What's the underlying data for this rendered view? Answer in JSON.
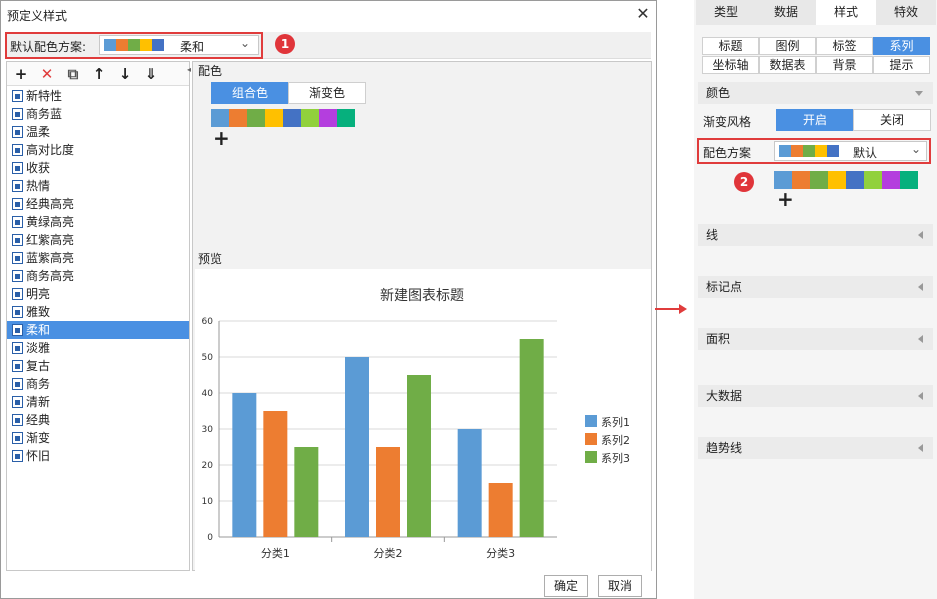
{
  "dialog": {
    "title": "预定义样式",
    "close": "✕",
    "default_scheme_label": "默认配色方案:",
    "default_scheme_value": "柔和",
    "marker": "1",
    "toolbar_icons": [
      "plus-icon",
      "delete-icon",
      "copy-icon",
      "up-arrow-icon",
      "down-arrow-icon",
      "sort-down-icon"
    ],
    "toolbar_glyphs": [
      "+",
      "✕",
      "⧉",
      "↑",
      "↓",
      "⇓"
    ],
    "schemes": [
      "新特性",
      "商务蓝",
      "温柔",
      "高对比度",
      "收获",
      "热情",
      "经典高亮",
      "黄绿高亮",
      "红紫高亮",
      "蓝紫高亮",
      "商务高亮",
      "明亮",
      "雅致",
      "柔和",
      "淡雅",
      "复古",
      "商务",
      "清新",
      "经典",
      "渐变",
      "怀旧"
    ],
    "selected_index": 13,
    "color_section_label": "配色",
    "color_tabs": [
      "组合色",
      "渐变色"
    ],
    "palette_colors": [
      "#5b9bd5",
      "#ed7d31",
      "#70ad47",
      "#ffc000",
      "#4472c4",
      "#91d13c",
      "#b43ede",
      "#06b07d"
    ],
    "scheme_swatch_colors": [
      "#5b9bd5",
      "#ed7d31",
      "#70ad47",
      "#ffc000",
      "#4472c4"
    ],
    "add": "+",
    "preview_label": "预览",
    "ok": "确定",
    "cancel": "取消"
  },
  "side": {
    "tabs": [
      "类型",
      "数据",
      "样式",
      "特效"
    ],
    "active_tab": 2,
    "subtabs": [
      "标题",
      "图例",
      "标签",
      "系列",
      "坐标轴",
      "数据表",
      "背景",
      "提示"
    ],
    "active_subtab": 3,
    "color_section": "颜色",
    "gradient_label": "渐变风格",
    "gradient_on": "开启",
    "gradient_off": "关闭",
    "scheme_label": "配色方案",
    "scheme_value": "默认",
    "marker": "2",
    "add": "+",
    "sections": [
      "线",
      "标记点",
      "面积",
      "大数据",
      "趋势线"
    ]
  },
  "chart_data": {
    "type": "bar",
    "title": "新建图表标题",
    "categories": [
      "分类1",
      "分类2",
      "分类3"
    ],
    "series": [
      {
        "name": "系列1",
        "values": [
          40,
          50,
          30
        ],
        "color": "#5b9bd5"
      },
      {
        "name": "系列2",
        "values": [
          35,
          25,
          15
        ],
        "color": "#ed7d31"
      },
      {
        "name": "系列3",
        "values": [
          25,
          45,
          55
        ],
        "color": "#70ad47"
      }
    ],
    "ylim": [
      0,
      60
    ],
    "yticks": [
      0,
      10,
      20,
      30,
      40,
      50,
      60
    ],
    "grid": true,
    "legend": "right"
  }
}
